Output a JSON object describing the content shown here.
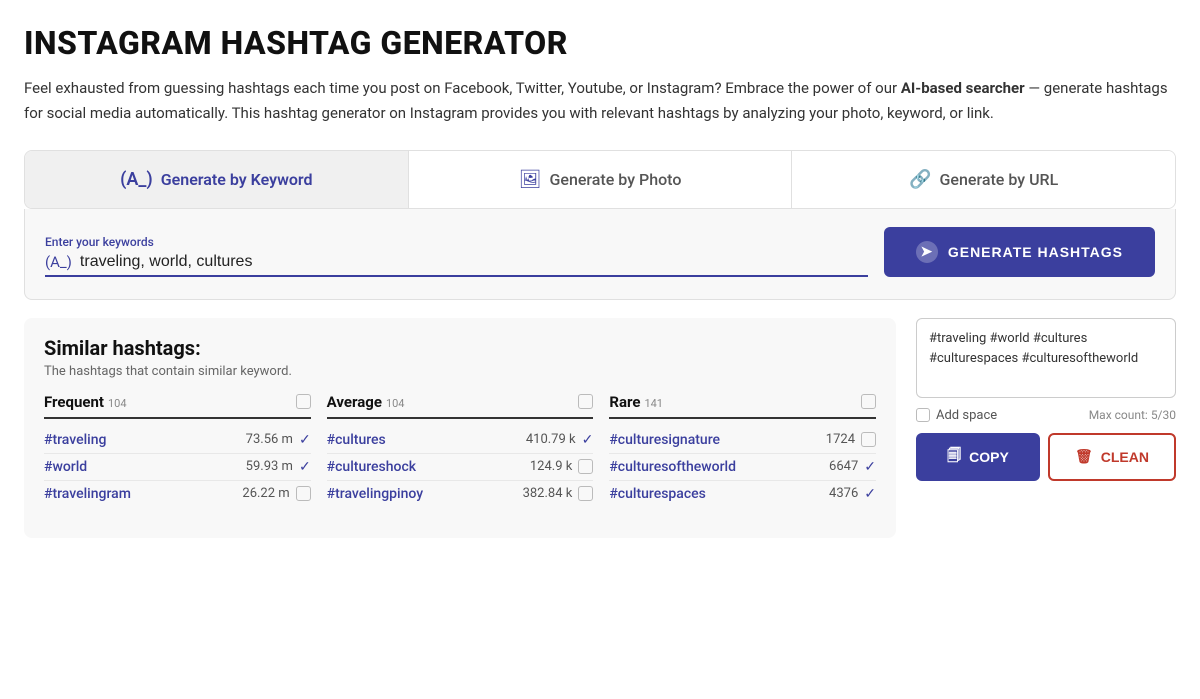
{
  "page": {
    "title": "INSTAGRAM HASHTAG GENERATOR",
    "description_parts": [
      "Feel exhausted from guessing hashtags each time you post on Facebook, Twitter, Youtube, or Instagram? Embrace the power of our ",
      "AI-based searcher",
      " — generate hashtags for social media automatically. This hashtag generator on Instagram provides you with relevant hashtags by analyzing your photo, keyword, or link."
    ]
  },
  "tabs": [
    {
      "id": "keyword",
      "label": "Generate by Keyword",
      "icon": "(A_)",
      "active": true
    },
    {
      "id": "photo",
      "label": "Generate by Photo",
      "icon": "🖼",
      "active": false
    },
    {
      "id": "url",
      "label": "Generate by URL",
      "icon": "🔗",
      "active": false
    }
  ],
  "input": {
    "label": "Enter your keywords",
    "icon": "(A_)",
    "value": "traveling, world, cultures",
    "placeholder": "Enter your keywords"
  },
  "generate_button": {
    "label": "GENERATE HASHTAGS"
  },
  "similar": {
    "title": "Similar hashtags:",
    "subtitle": "The hashtags that contain similar keyword."
  },
  "columns": [
    {
      "id": "frequent",
      "label": "Frequent",
      "count": "104",
      "items": [
        {
          "tag": "#traveling",
          "count": "73.56 m",
          "checked": true
        },
        {
          "tag": "#world",
          "count": "59.93 m",
          "checked": true
        },
        {
          "tag": "#travelingram",
          "count": "26.22 m",
          "checked": false
        }
      ]
    },
    {
      "id": "average",
      "label": "Average",
      "count": "104",
      "items": [
        {
          "tag": "#cultures",
          "count": "410.79 k",
          "checked": true
        },
        {
          "tag": "#cultureshock",
          "count": "124.9 k",
          "checked": false
        },
        {
          "tag": "#travelingpinoy",
          "count": "382.84 k",
          "checked": false
        }
      ]
    },
    {
      "id": "rare",
      "label": "Rare",
      "count": "141",
      "items": [
        {
          "tag": "#culturesignature",
          "count": "1724",
          "checked": false
        },
        {
          "tag": "#culturesoftheworld",
          "count": "6647",
          "checked": true
        },
        {
          "tag": "#culturespaces",
          "count": "4376",
          "checked": true
        }
      ]
    }
  ],
  "output": {
    "text": "#traveling #world #cultures #culturespaces\n#culturesoftheworld"
  },
  "sidebar": {
    "add_space_label": "Add space",
    "max_count_label": "Max count: 5/30"
  },
  "buttons": {
    "copy": "COPY",
    "clean": "CLEAN"
  }
}
